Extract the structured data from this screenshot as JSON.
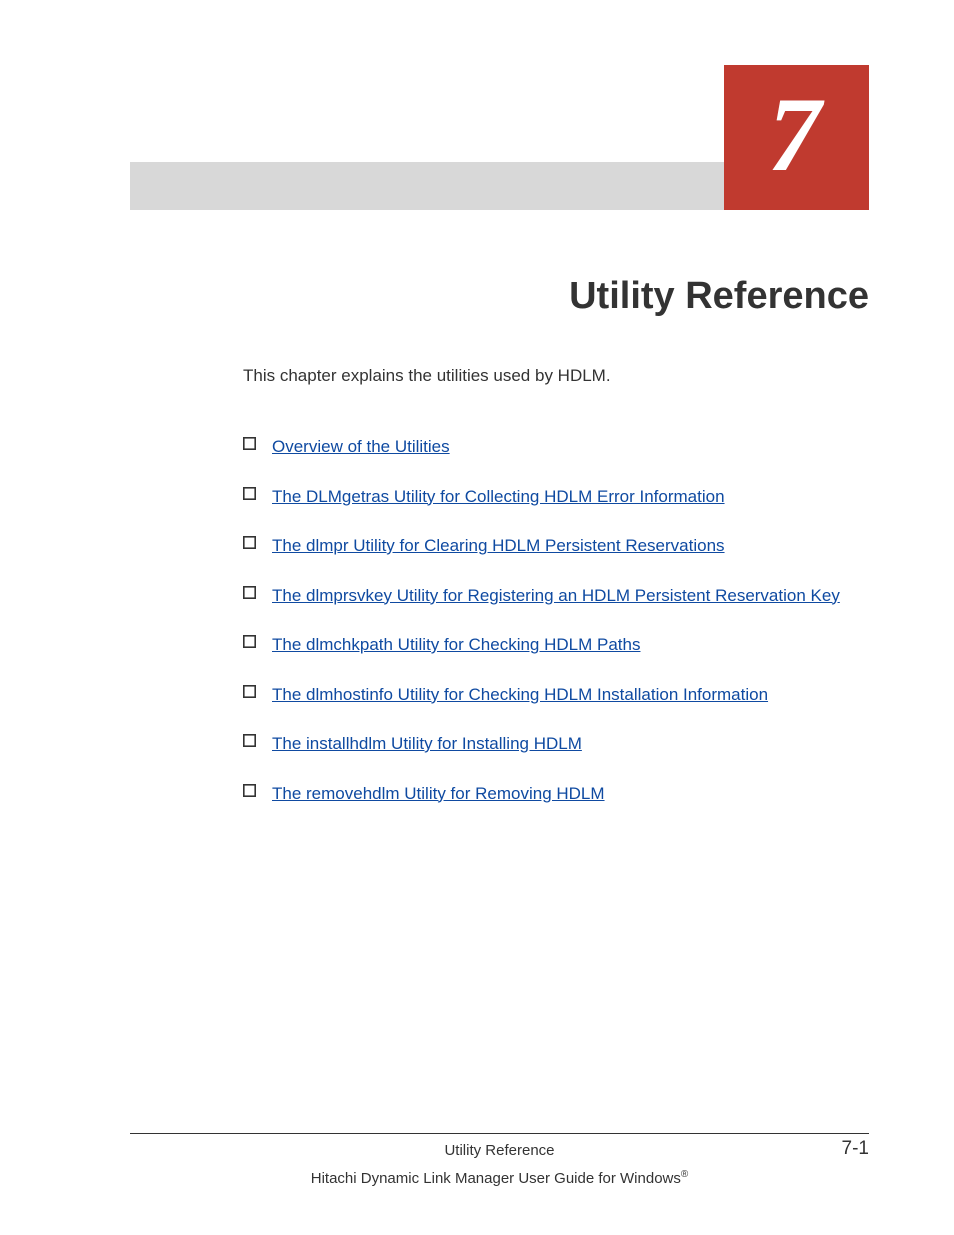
{
  "chapter": {
    "number": "7",
    "title": "Utility Reference"
  },
  "intro": "This chapter explains the utilities used by HDLM.",
  "toc": [
    "Overview of the Utilities",
    "The DLMgetras Utility for Collecting HDLM Error Information",
    "The dlmpr Utility for Clearing HDLM Persistent Reservations",
    "The dlmprsvkey Utility for Registering an HDLM Persistent Reservation Key",
    "The dlmchkpath Utility for Checking HDLM Paths",
    "The dlmhostinfo Utility for Checking HDLM Installation Information",
    "The installhdlm Utility for Installing HDLM",
    "The removehdlm Utility for Removing HDLM"
  ],
  "footer": {
    "section": "Utility Reference",
    "page": "7-1",
    "book_prefix": "Hitachi Dynamic Link Manager User Guide for Windows",
    "reg": "®"
  }
}
